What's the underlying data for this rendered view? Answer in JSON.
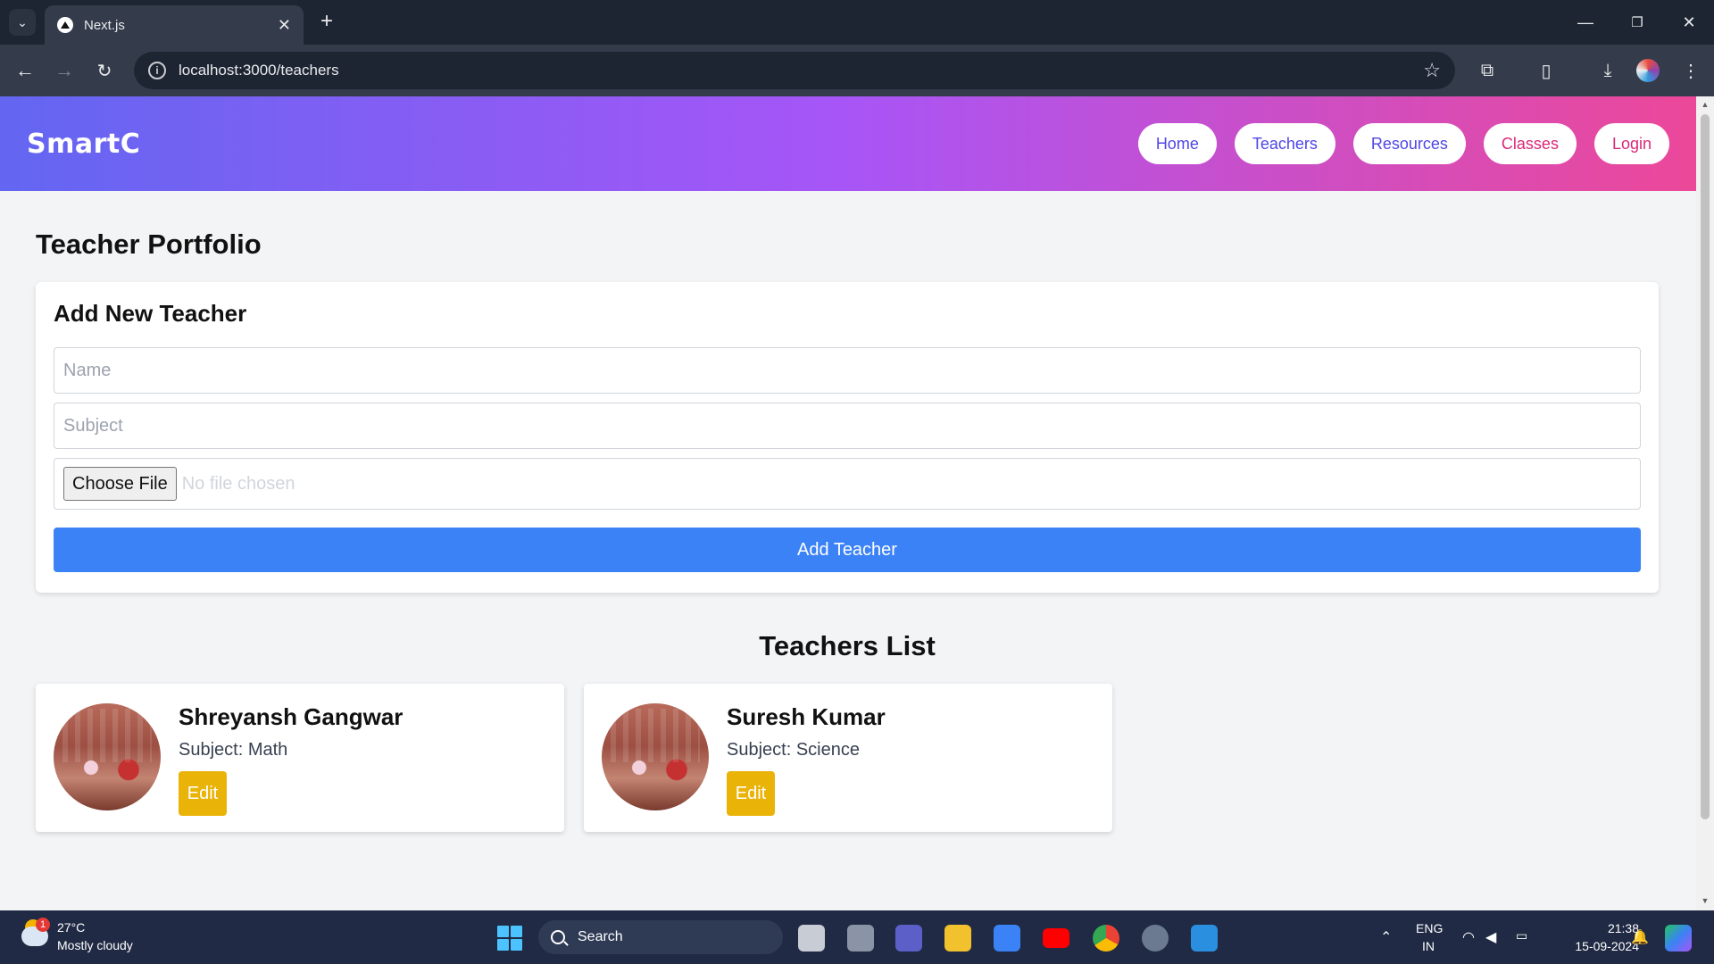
{
  "browser": {
    "tab_title": "Next.js",
    "url": "localhost:3000/teachers"
  },
  "header": {
    "brand": "SmartC",
    "nav": [
      {
        "label": "Home"
      },
      {
        "label": "Teachers"
      },
      {
        "label": "Resources"
      },
      {
        "label": "Classes"
      },
      {
        "label": "Login"
      }
    ]
  },
  "page": {
    "title": "Teacher Portfolio"
  },
  "form": {
    "title": "Add New Teacher",
    "name_placeholder": "Name",
    "subject_placeholder": "Subject",
    "file_button": "Choose File",
    "file_status": "No file chosen",
    "submit_label": "Add Teacher"
  },
  "list": {
    "title": "Teachers List",
    "teachers": [
      {
        "name": "Shreyansh Gangwar",
        "subject": "Subject: Math",
        "edit_label": "Edit"
      },
      {
        "name": "Suresh Kumar",
        "subject": "Subject: Science",
        "edit_label": "Edit"
      }
    ]
  },
  "taskbar": {
    "weather_badge": "1",
    "temperature": "27°C",
    "weather": "Mostly cloudy",
    "search_label": "Search",
    "lang_top": "ENG",
    "lang_bottom": "IN",
    "time": "21:38",
    "date": "15-09-2024"
  },
  "colors": {
    "header_gradient": [
      "#6366f1",
      "#a855f7",
      "#ec4899"
    ],
    "primary": "#3b82f6",
    "edit": "#eab308"
  }
}
